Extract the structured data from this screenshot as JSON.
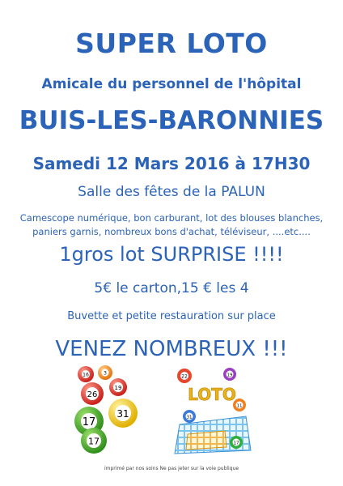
{
  "poster": {
    "title": "SUPER LOTO",
    "organizer": "Amicale du personnel de l'hôpital",
    "town": "BUIS-LES-BARONNIES",
    "date": "Samedi 12 Mars 2016 à 17H30",
    "venue": "Salle des fêtes de la PALUN",
    "prizes_line1": "Camescope numérique, bon carburant, lot des blouses blanches,",
    "prizes_line2": "paniers garnis, nombreux bons d'achat, téléviseur, ....etc....",
    "surprise": "1gros lot SURPRISE !!!!",
    "price": "5€ le carton,15 € les 4",
    "refreshments": "Buvette et petite restauration sur place",
    "call": "VENEZ NOMBREUX !!!",
    "imprint": "imprimé par nos soins Ne pas jeter sur la voie publique"
  },
  "balls": {
    "left_group": [
      "26",
      "31",
      "17",
      "17",
      "19",
      "16",
      "3"
    ],
    "right_group_title": "LOTO",
    "right_group": [
      "22",
      "19",
      "11",
      "31",
      "17"
    ]
  },
  "colors": {
    "text": "#2b63b8"
  }
}
